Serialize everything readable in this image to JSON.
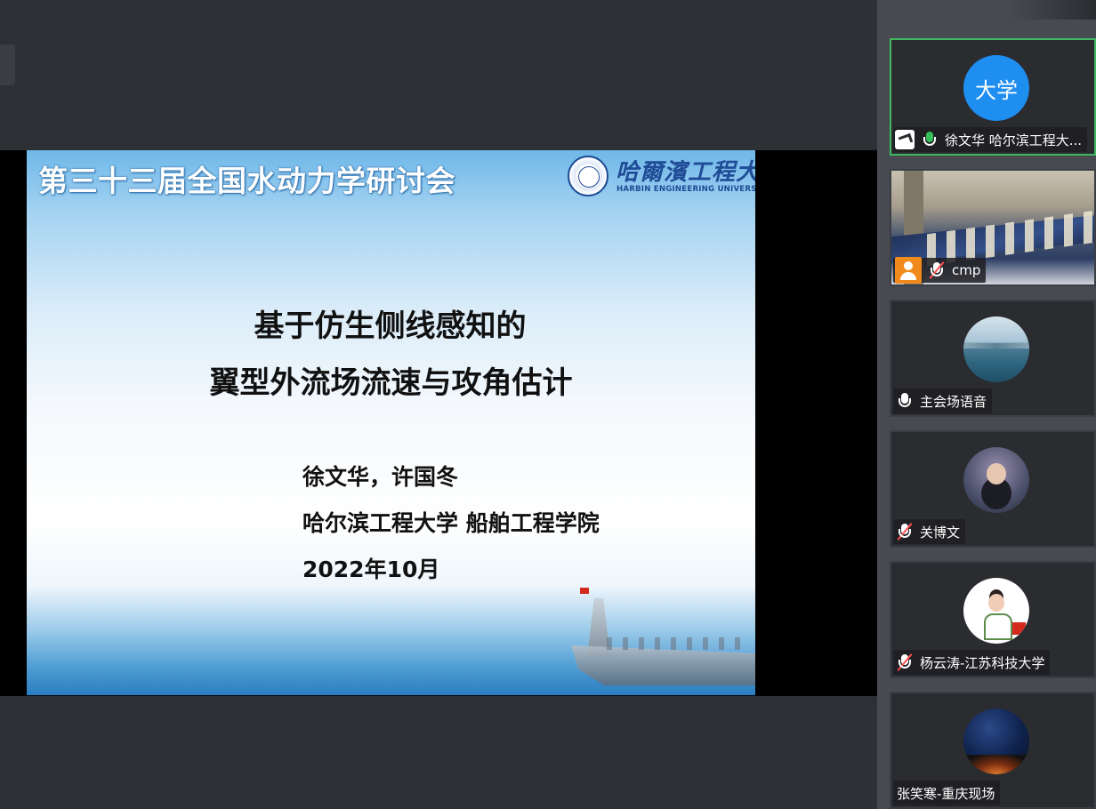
{
  "slide": {
    "conference_title": "第三十三届全国水动力学研讨会",
    "logo_cn": "哈爾濱工程大學",
    "logo_en": "HARBIN ENGINEERING UNIVERSITY",
    "talk_title_line1": "基于仿生侧线感知的",
    "talk_title_line2": "翼型外流场流速与攻角估计",
    "authors": "徐文华，许国冬",
    "affiliation": "哈尔滨工程大学 船舶工程学院",
    "date": "2022年10月"
  },
  "participants": [
    {
      "name": "徐文华 哈尔滨工程大...",
      "avatar_text": "大学",
      "avatar": "text",
      "mic": "active",
      "sharing": true,
      "active": true
    },
    {
      "name": "cmp",
      "avatar": "video",
      "mic": "muted",
      "badge": "user-icon"
    },
    {
      "name": "主会场语音",
      "avatar": "sea",
      "mic": "on"
    },
    {
      "name": "关博文",
      "avatar": "cartoon",
      "mic": "muted"
    },
    {
      "name": "杨云涛-江苏科技大学",
      "avatar": "person",
      "mic": "muted"
    },
    {
      "name": "张笑寒-重庆现场",
      "avatar": "night",
      "mic": "none"
    }
  ],
  "colors": {
    "stage_bg": "#2d3034",
    "rail_bg": "#474b51",
    "active_border": "#3fb85f",
    "accent_blue": "#1f8ef1",
    "muted_red": "#ff4d4f"
  }
}
